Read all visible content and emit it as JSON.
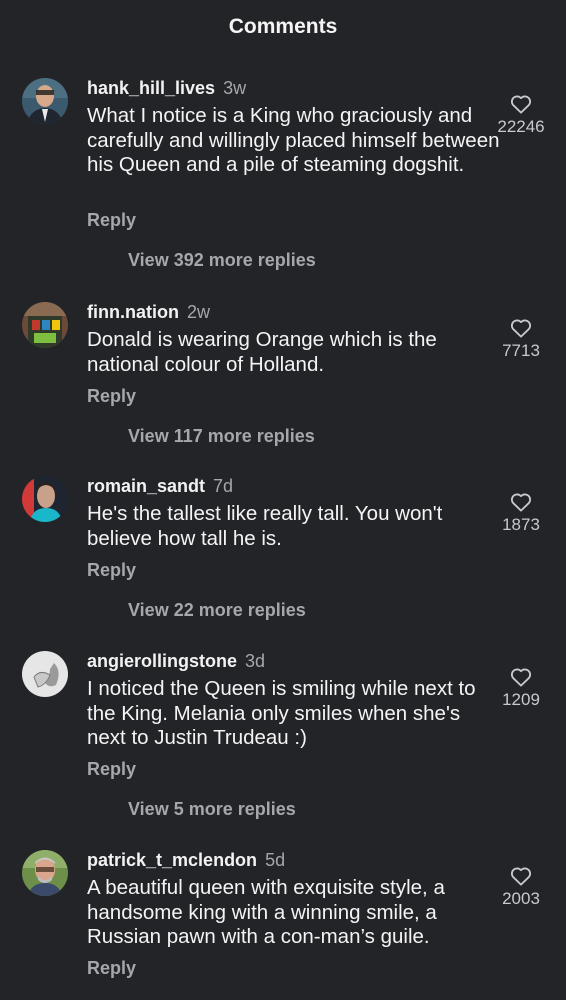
{
  "header": {
    "title": "Comments"
  },
  "comments": [
    {
      "username": "hank_hill_lives",
      "time": "3w",
      "text": "What I notice is a King who graciously and carefully and willingly placed himself between his Queen and a pile of steaming dogshit.",
      "reply_label": "Reply",
      "view_replies": "View 392 more replies",
      "likes": "22246"
    },
    {
      "username": "finn.nation",
      "time": "2w",
      "text": "Donald is wearing Orange which is the national colour of Holland.",
      "reply_label": "Reply",
      "view_replies": "View 117 more replies",
      "likes": "7713"
    },
    {
      "username": "romain_sandt",
      "time": "7d",
      "text": "He's the tallest like really tall. You won't believe how tall he is.",
      "reply_label": "Reply",
      "view_replies": "View 22 more replies",
      "likes": "1873"
    },
    {
      "username": "angierollingstone",
      "time": "3d",
      "text": "I noticed the Queen is smiling while next to the King. Melania only smiles when she's next to Justin Trudeau :)",
      "reply_label": "Reply",
      "view_replies": "View 5 more replies",
      "likes": "1209"
    },
    {
      "username": "patrick_t_mclendon",
      "time": "5d",
      "text": "A beautiful queen with exquisite style, a handsome king with a winning smile, a Russian pawn with a con-man’s guile.",
      "reply_label": "Reply",
      "likes": "2003"
    }
  ],
  "icons": {
    "like": "heart-outline-icon"
  },
  "colors": {
    "background": "#232428",
    "muted_text": "#a6a7ab",
    "primary_text": "#f4f4f4"
  }
}
